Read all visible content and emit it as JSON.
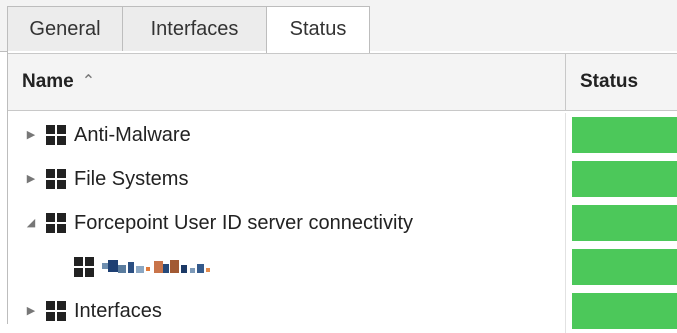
{
  "tabs": [
    {
      "label": "General",
      "active": false
    },
    {
      "label": "Interfaces",
      "active": false
    },
    {
      "label": "Status",
      "active": true
    }
  ],
  "table": {
    "columns": {
      "name": "Name",
      "status": "Status",
      "sort_indicator": "^"
    },
    "status_color": "#4cc85a",
    "rows": [
      {
        "label": "Anti-Malware",
        "expanded": false,
        "icon": "grid-icon",
        "status": "green"
      },
      {
        "label": "File Systems",
        "expanded": false,
        "icon": "grid-icon",
        "status": "green"
      },
      {
        "label": "Forcepoint User ID server connectivity",
        "expanded": true,
        "icon": "grid-icon",
        "status": "green"
      },
      {
        "label": "",
        "child": true,
        "redacted": true,
        "icon": "grid-icon",
        "status": "green"
      },
      {
        "label": "Interfaces",
        "expanded": false,
        "icon": "grid-icon",
        "status": "green"
      }
    ]
  }
}
